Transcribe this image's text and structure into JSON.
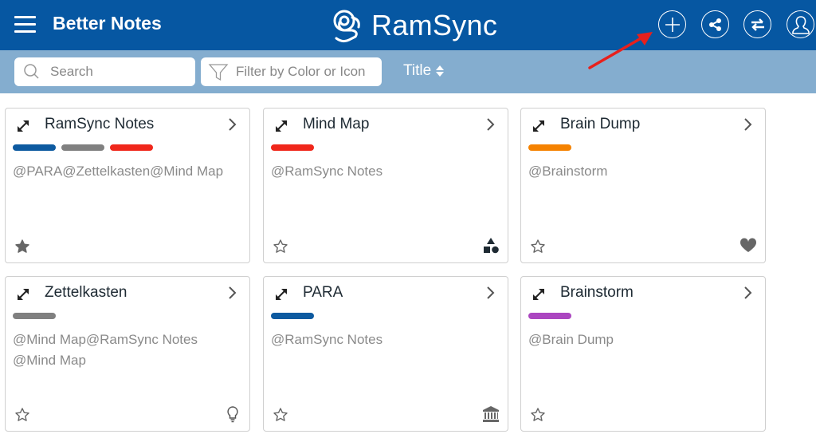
{
  "header": {
    "app_title": "Better Notes",
    "logo_text": "RamSync",
    "buttons": [
      {
        "name": "add",
        "icon": "plus-icon"
      },
      {
        "name": "share",
        "icon": "share-icon"
      },
      {
        "name": "sync",
        "icon": "swap-arrows-icon"
      },
      {
        "name": "profile",
        "icon": "user-icon"
      }
    ]
  },
  "toolbar": {
    "search_placeholder": "Search",
    "filter_placeholder": "Filter by Color or Icon",
    "sort_label": "Title"
  },
  "colors": {
    "header_bg": "#0657a2",
    "toolbar_bg": "#84adcf",
    "blue": "#0d5aa0",
    "gray": "#808080",
    "red": "#f0271b",
    "orange": "#f58200",
    "purple": "#ab46c0",
    "annotation_arrow": "#e8201c"
  },
  "cards": [
    {
      "title": "RamSync Notes",
      "tags": [
        "#0d5aa0",
        "#808080",
        "#f0271b"
      ],
      "links": "@PARA@Zettelkasten@Mind Map",
      "favorite": true,
      "icon": ""
    },
    {
      "title": "Mind Map",
      "tags": [
        "#f0271b"
      ],
      "links": "@RamSync Notes",
      "favorite": false,
      "icon": "shapes-icon"
    },
    {
      "title": "Brain Dump",
      "tags": [
        "#f58200"
      ],
      "links": "@Brainstorm",
      "favorite": false,
      "icon": "heart-icon"
    },
    {
      "title": "Zettelkasten",
      "tags": [
        "#808080"
      ],
      "links": "@Mind Map@RamSync Notes @Mind Map",
      "favorite": false,
      "icon": "lightbulb-icon"
    },
    {
      "title": "PARA",
      "tags": [
        "#0d5aa0"
      ],
      "links": "@RamSync Notes",
      "favorite": false,
      "icon": "bank-icon"
    },
    {
      "title": "Brainstorm",
      "tags": [
        "#ab46c0"
      ],
      "links": "@Brain Dump",
      "favorite": false,
      "icon": ""
    }
  ]
}
